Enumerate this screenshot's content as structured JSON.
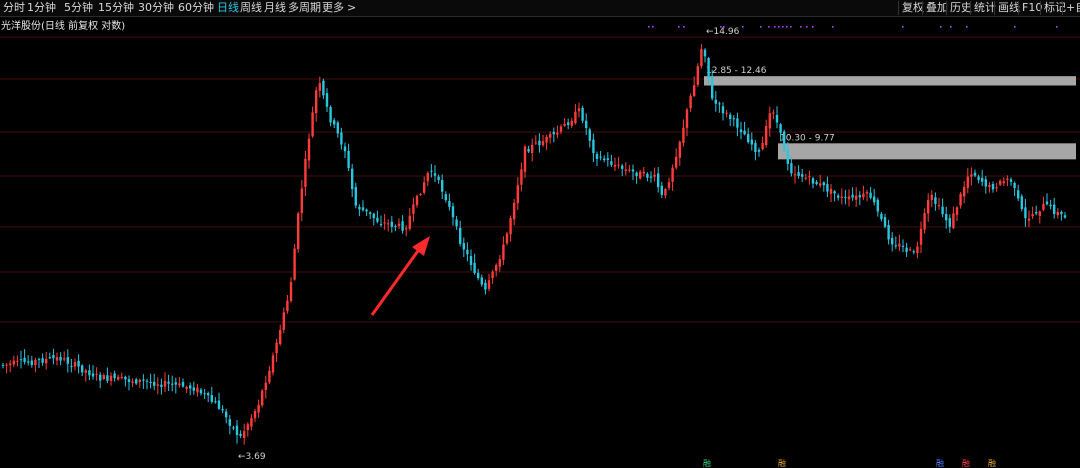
{
  "toolbar": {
    "tabs": [
      "分时",
      "1分钟",
      "5分钟",
      "15分钟",
      "30分钟",
      "60分钟",
      "日线",
      "周线",
      "月线",
      "多周期",
      "更多"
    ],
    "more_arrow": ">",
    "active_tab": "日线",
    "right_buttons": [
      "复权",
      "叠加",
      "历史",
      "统计",
      "画线",
      "F10",
      "标记",
      "+自选"
    ]
  },
  "stock_title": "光洋股份(日线 前复权 对数)",
  "colors": {
    "up": "#ff3b3b",
    "down": "#29c6e0",
    "gridline": "#4a0d0d",
    "zone": "#b4b4b4",
    "arrow": "#ff2a2a",
    "active_tab": "#29c6e0"
  },
  "chart_data": {
    "type": "candlestick",
    "scale": "log",
    "low_label": "3.69",
    "high_label": "14.96",
    "zones": [
      {
        "label": "12.85 - 12.46",
        "top": 12.85,
        "bottom": 12.46
      },
      {
        "label": "10.30 - 9.77",
        "top": 10.3,
        "bottom": 9.77
      }
    ],
    "bottom_markers": [
      "融",
      "融",
      "融",
      "融",
      "融"
    ]
  }
}
